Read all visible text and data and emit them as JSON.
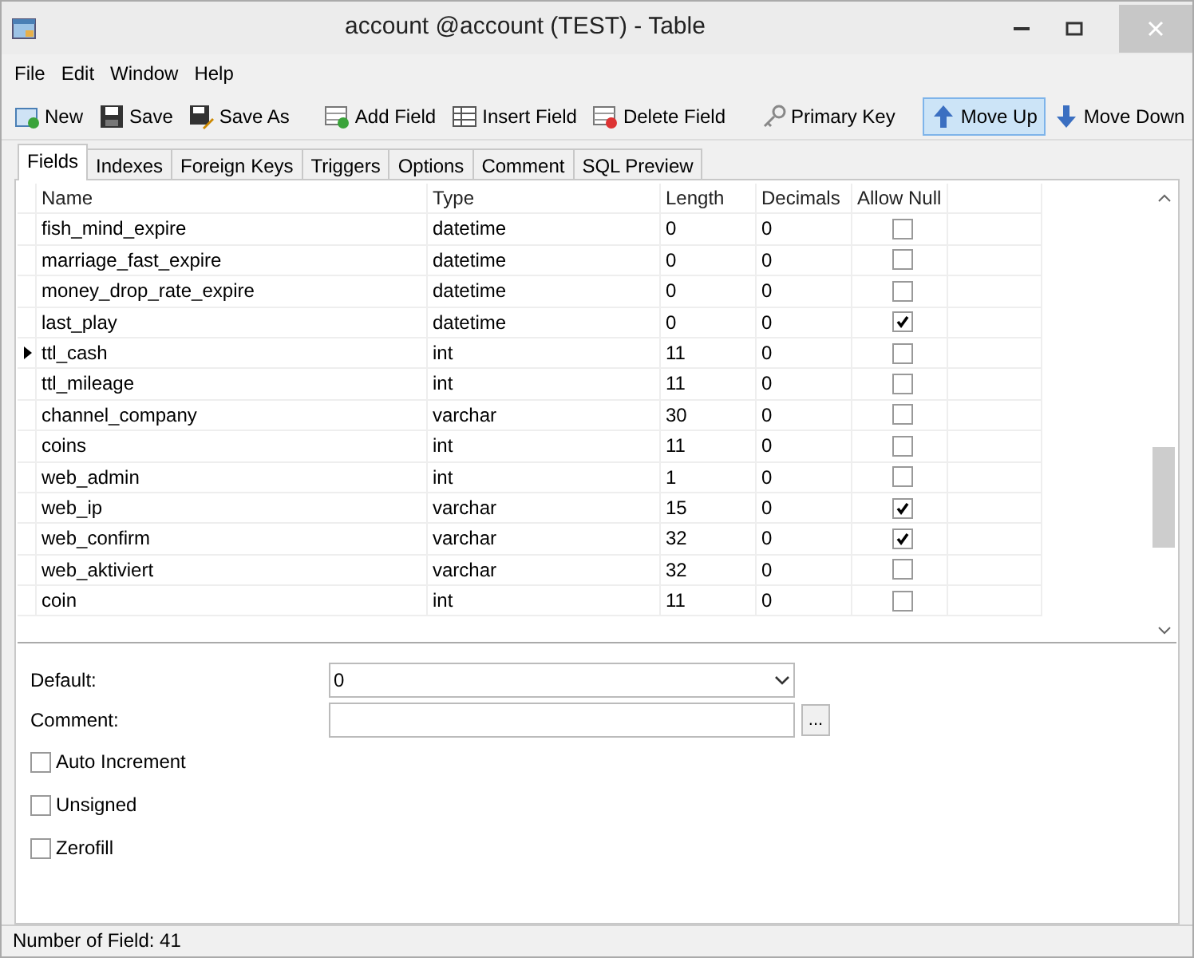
{
  "window": {
    "title": "account @account (TEST) - Table"
  },
  "menu": [
    "File",
    "Edit",
    "Window",
    "Help"
  ],
  "toolbar": [
    [
      {
        "label": "New",
        "pressed": false
      },
      {
        "label": "Save",
        "pressed": false
      },
      {
        "label": "Save As",
        "pressed": false
      }
    ],
    [
      {
        "label": "Add Field",
        "pressed": false
      },
      {
        "label": "Insert Field",
        "pressed": false
      },
      {
        "label": "Delete Field",
        "pressed": false
      }
    ],
    [
      {
        "label": "Primary Key",
        "pressed": false
      }
    ],
    [
      {
        "label": "Move Up",
        "pressed": true
      },
      {
        "label": "Move Down",
        "pressed": false
      }
    ]
  ],
  "tabs": [
    {
      "label": "Fields",
      "selected": true
    },
    {
      "label": "Indexes",
      "selected": false
    },
    {
      "label": "Foreign Keys",
      "selected": false
    },
    {
      "label": "Triggers",
      "selected": false
    },
    {
      "label": "Options",
      "selected": false
    },
    {
      "label": "Comment",
      "selected": false
    },
    {
      "label": "SQL Preview",
      "selected": false
    }
  ],
  "table": {
    "columns": [
      "Name",
      "Type",
      "Length",
      "Decimals",
      "Allow Null"
    ],
    "rows": [
      {
        "name": "fish_mind_expire",
        "type": "datetime",
        "length": "0",
        "decimals": "0",
        "allow_null": false,
        "current": false
      },
      {
        "name": "marriage_fast_expire",
        "type": "datetime",
        "length": "0",
        "decimals": "0",
        "allow_null": false,
        "current": false
      },
      {
        "name": "money_drop_rate_expire",
        "type": "datetime",
        "length": "0",
        "decimals": "0",
        "allow_null": false,
        "current": false
      },
      {
        "name": "last_play",
        "type": "datetime",
        "length": "0",
        "decimals": "0",
        "allow_null": true,
        "current": false
      },
      {
        "name": "ttl_cash",
        "type": "int",
        "length": "11",
        "decimals": "0",
        "allow_null": false,
        "current": true
      },
      {
        "name": "ttl_mileage",
        "type": "int",
        "length": "11",
        "decimals": "0",
        "allow_null": false,
        "current": false
      },
      {
        "name": "channel_company",
        "type": "varchar",
        "length": "30",
        "decimals": "0",
        "allow_null": false,
        "current": false
      },
      {
        "name": "coins",
        "type": "int",
        "length": "11",
        "decimals": "0",
        "allow_null": false,
        "current": false
      },
      {
        "name": "web_admin",
        "type": "int",
        "length": "1",
        "decimals": "0",
        "allow_null": false,
        "current": false
      },
      {
        "name": "web_ip",
        "type": "varchar",
        "length": "15",
        "decimals": "0",
        "allow_null": true,
        "current": false
      },
      {
        "name": "web_confirm",
        "type": "varchar",
        "length": "32",
        "decimals": "0",
        "allow_null": true,
        "current": false
      },
      {
        "name": "web_aktiviert",
        "type": "varchar",
        "length": "32",
        "decimals": "0",
        "allow_null": false,
        "current": false
      },
      {
        "name": "coin",
        "type": "int",
        "length": "11",
        "decimals": "0",
        "allow_null": false,
        "current": false
      }
    ]
  },
  "properties": {
    "default": {
      "label": "Default:",
      "value": "0"
    },
    "comment": {
      "label": "Comment:",
      "button": "..."
    },
    "options": [
      {
        "label": "Auto Increment",
        "checked": false
      },
      {
        "label": "Unsigned",
        "checked": false
      },
      {
        "label": "Zerofill",
        "checked": false
      }
    ]
  },
  "status_bar": "Number of Field: 41"
}
